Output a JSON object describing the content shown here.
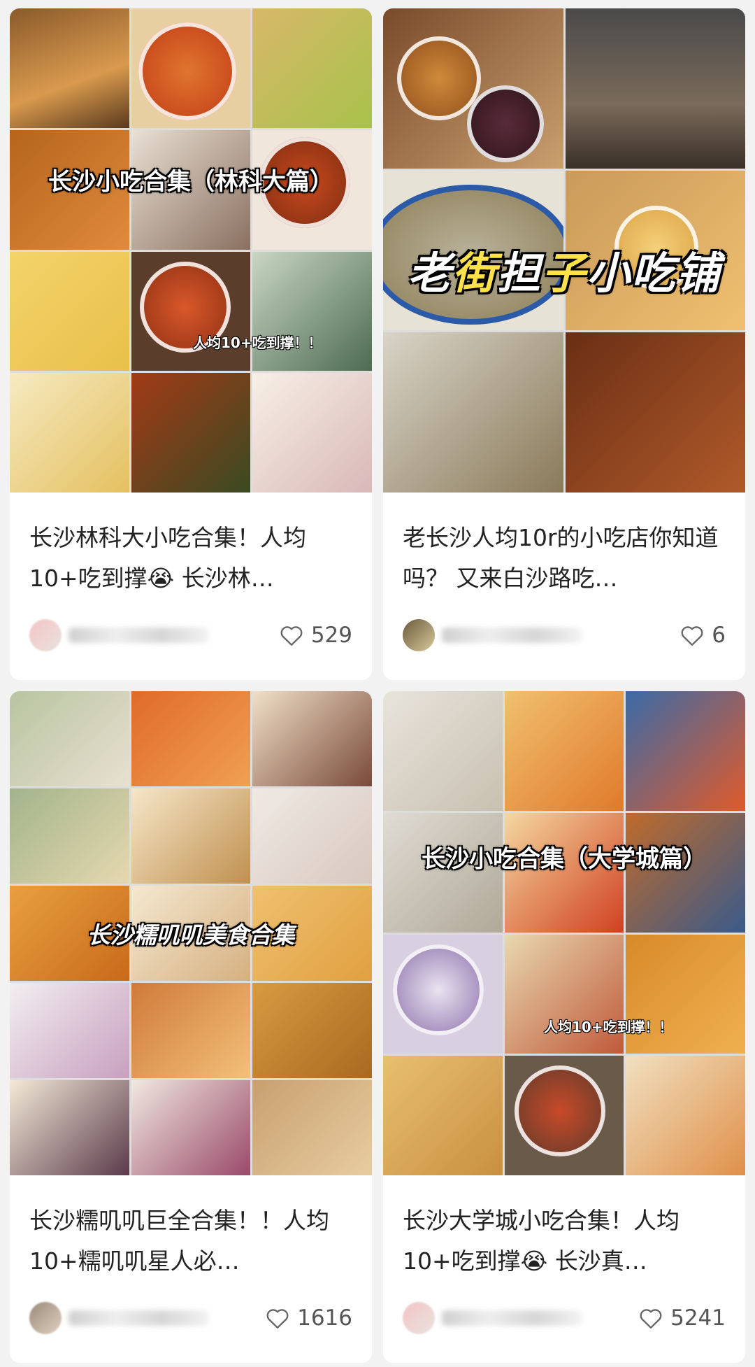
{
  "cards": [
    {
      "overlay": "长沙小吃合集（林科大篇）",
      "overlay_tag": "人均10+吃到撑！！",
      "title": "长沙林科大小吃合集！人均10+吃到撑😭 长沙林…",
      "likes": "529"
    },
    {
      "overlay_parts": [
        "老",
        "街",
        "担",
        "子",
        "小吃铺"
      ],
      "title": "老长沙人均10r的小吃店你知道吗？ 又来白沙路吃…",
      "likes": "6"
    },
    {
      "overlay": "长沙糯叽叽美食合集",
      "title": "长沙糯叽叽巨全合集！！人均10+糯叽叽星人必…",
      "likes": "1616"
    },
    {
      "overlay": "长沙小吃合集（大学城篇）",
      "overlay_tag": "人均10+吃到撑！！",
      "title": "长沙大学城小吃合集！人均10+吃到撑😭 长沙真…",
      "likes": "5241"
    }
  ],
  "icons": {
    "like": "heart-outline-icon"
  },
  "colors": {
    "background": "#f2f2f2",
    "card": "#ffffff",
    "overlay_yellow": "#ffe24a"
  }
}
